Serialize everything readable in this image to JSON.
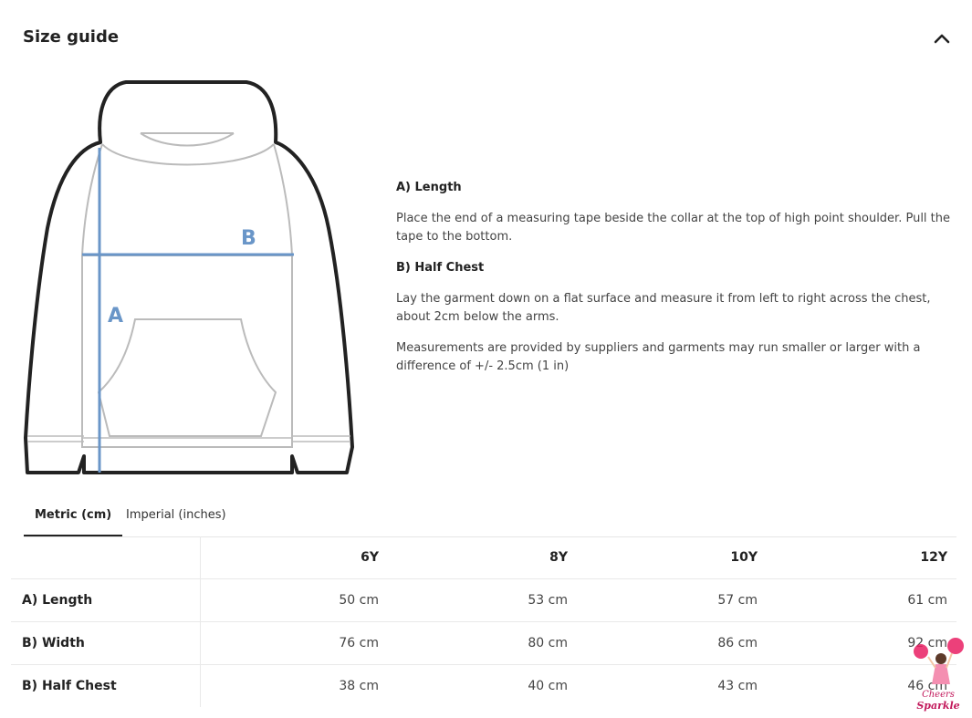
{
  "header": {
    "title": "Size guide",
    "collapse_icon": "chevron-up-icon"
  },
  "illustration": {
    "label_a": "A",
    "label_b": "B",
    "measure_color": "#6a96c8"
  },
  "info": {
    "length_heading": "A) Length",
    "length_text": "Place the end of a measuring tape beside the collar at the top of high point shoulder. Pull the tape to the bottom.",
    "chest_heading": "B) Half Chest",
    "chest_text": "Lay the garment down on a flat surface and measure it from left to right across the chest, about 2cm below the arms.",
    "note": "Measurements are provided by suppliers and garments may run smaller or larger with a difference of +/- 2.5cm (1 in)"
  },
  "tabs": [
    {
      "label": "Metric (cm)",
      "active": true
    },
    {
      "label": "Imperial (inches)",
      "active": false
    }
  ],
  "table": {
    "columns": [
      "6Y",
      "8Y",
      "10Y",
      "12Y"
    ],
    "rows": [
      {
        "label": "A) Length",
        "values": [
          "50 cm",
          "53 cm",
          "57 cm",
          "61 cm"
        ]
      },
      {
        "label": "B) Width",
        "values": [
          "76 cm",
          "80 cm",
          "86 cm",
          "92 cm"
        ]
      },
      {
        "label": "B) Half Chest",
        "values": [
          "38 cm",
          "40 cm",
          "43 cm",
          "46 cm"
        ]
      }
    ]
  },
  "watermark": {
    "text_line1": "Cheers",
    "text_line2": "Sparkle",
    "color": "#c2185b"
  }
}
